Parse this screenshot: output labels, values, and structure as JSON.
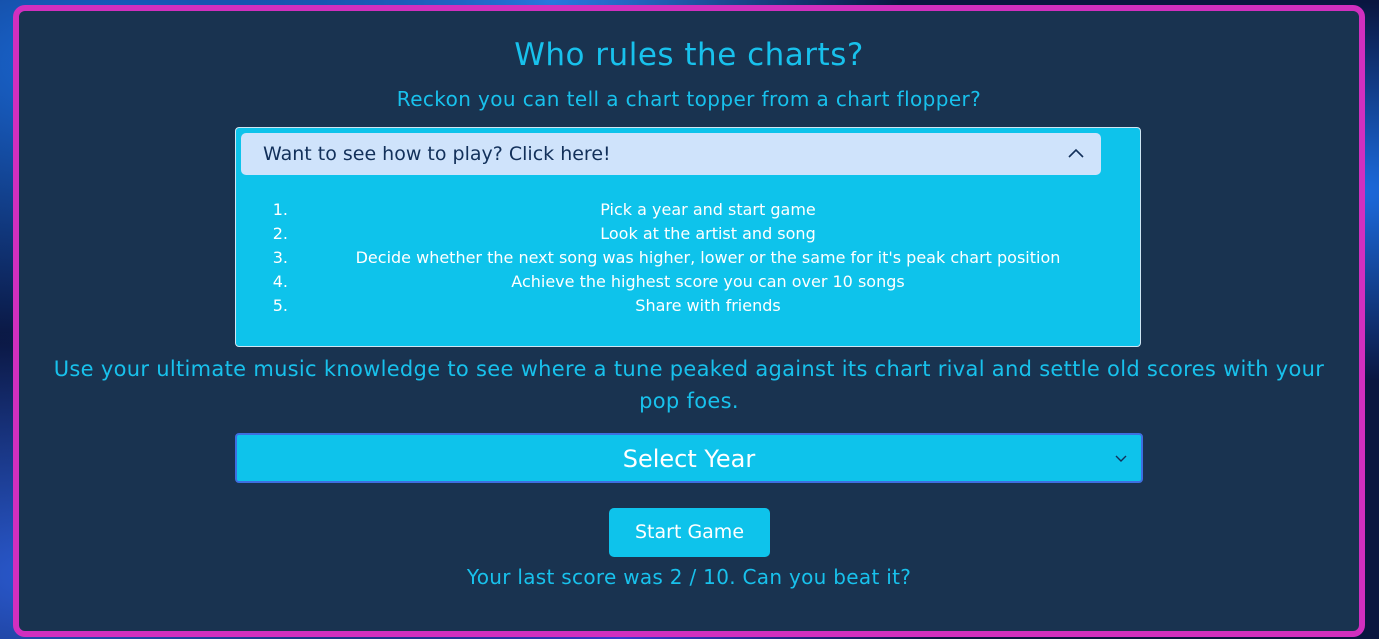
{
  "header": {
    "title": "Who rules the charts?",
    "subtitle": "Reckon you can tell a chart topper from a chart flopper?"
  },
  "howto": {
    "toggle_label": "Want to see how to play? Click here!",
    "toggle_icon": "chevron-up-icon",
    "expanded": true,
    "steps": [
      {
        "num": "1.",
        "text": "Pick a year and start game"
      },
      {
        "num": "2.",
        "text": "Look at the artist and song"
      },
      {
        "num": "3.",
        "text": "Decide whether the next song was higher, lower or the same for it's peak chart position"
      },
      {
        "num": "4.",
        "text": "Achieve the highest score you can over 10 songs"
      },
      {
        "num": "5.",
        "text": "Share with friends"
      }
    ]
  },
  "description": "Use your ultimate music knowledge to see where a tune peaked against its chart rival and settle old scores with your pop foes.",
  "year_select": {
    "selected": "Select Year",
    "icon": "chevron-down-icon"
  },
  "start_button": {
    "label": "Start Game"
  },
  "last_score": {
    "text": "Your last score was 2 / 10. Can you beat it?"
  },
  "colors": {
    "frame_border": "#d12fbf",
    "panel_bg": "#193350",
    "accent": "#0ec3eb",
    "text_accent": "#18c1ec",
    "howto_header_bg": "#cfe3fb"
  }
}
